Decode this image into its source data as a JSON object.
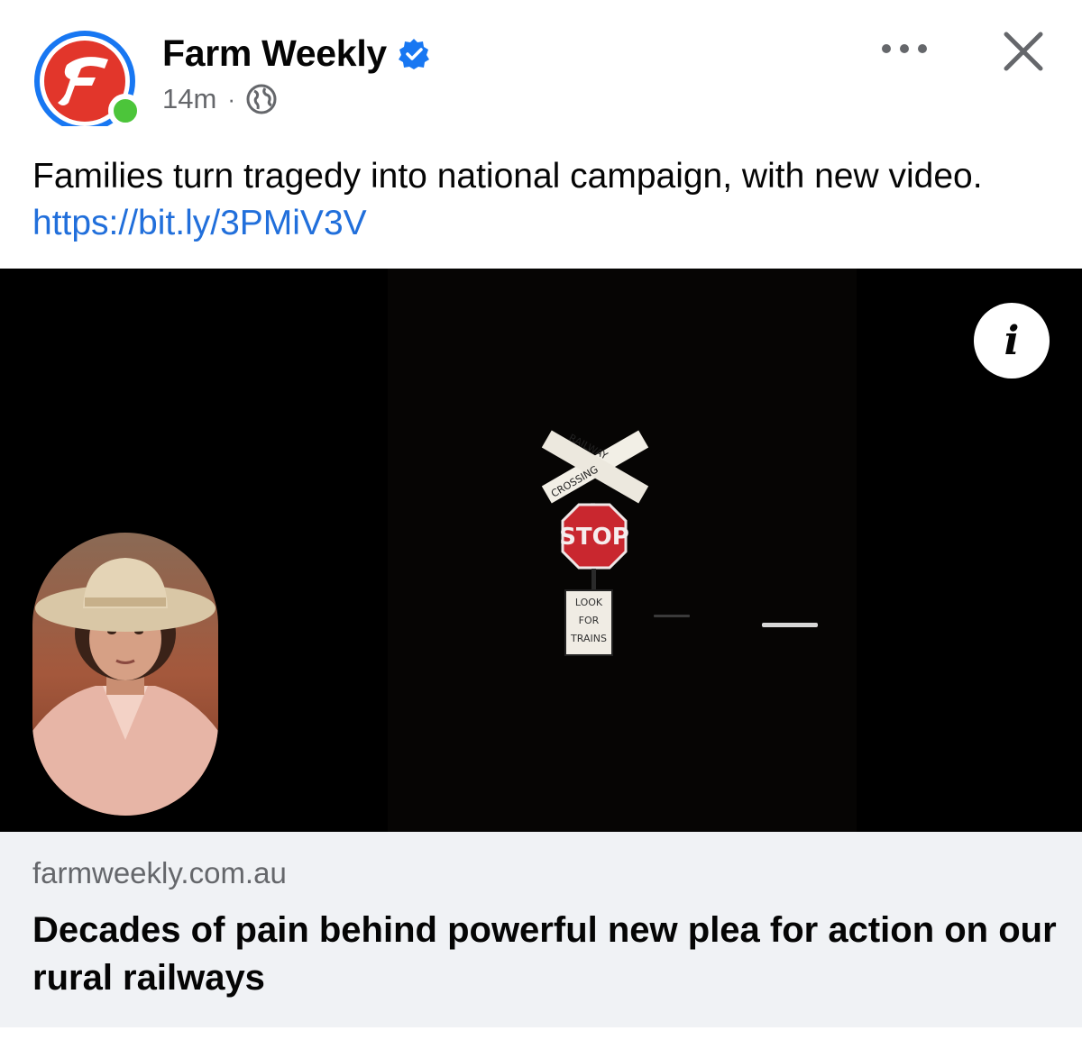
{
  "post": {
    "author": "Farm Weekly",
    "verified_icon": "verified-badge-icon",
    "time": "14m",
    "separator": "·",
    "audience_icon": "globe-icon",
    "text": "Families turn tragedy into national campaign, with new video. ",
    "link": "https://bit.ly/3PMiV3V"
  },
  "header_actions": {
    "more_icon": "more-options-icon",
    "close_icon": "close-icon"
  },
  "media": {
    "info_label": "i",
    "sign_crossbuck_text_1": "RAILWAY",
    "sign_crossbuck_text_2": "CROSSING",
    "sign_stop": "STOP",
    "sign_look_1": "LOOK",
    "sign_look_2": "FOR",
    "sign_look_3": "TRAINS"
  },
  "link_preview": {
    "domain": "farmweekly.com.au",
    "headline": "Decades of pain behind powerful new plea for action on our rural railways"
  },
  "colors": {
    "brand_red": "#e2362b",
    "brand_blue": "#1877f2",
    "online_green": "#4cc53a",
    "link_blue": "#216fdb",
    "card_bg": "#f0f2f5"
  }
}
